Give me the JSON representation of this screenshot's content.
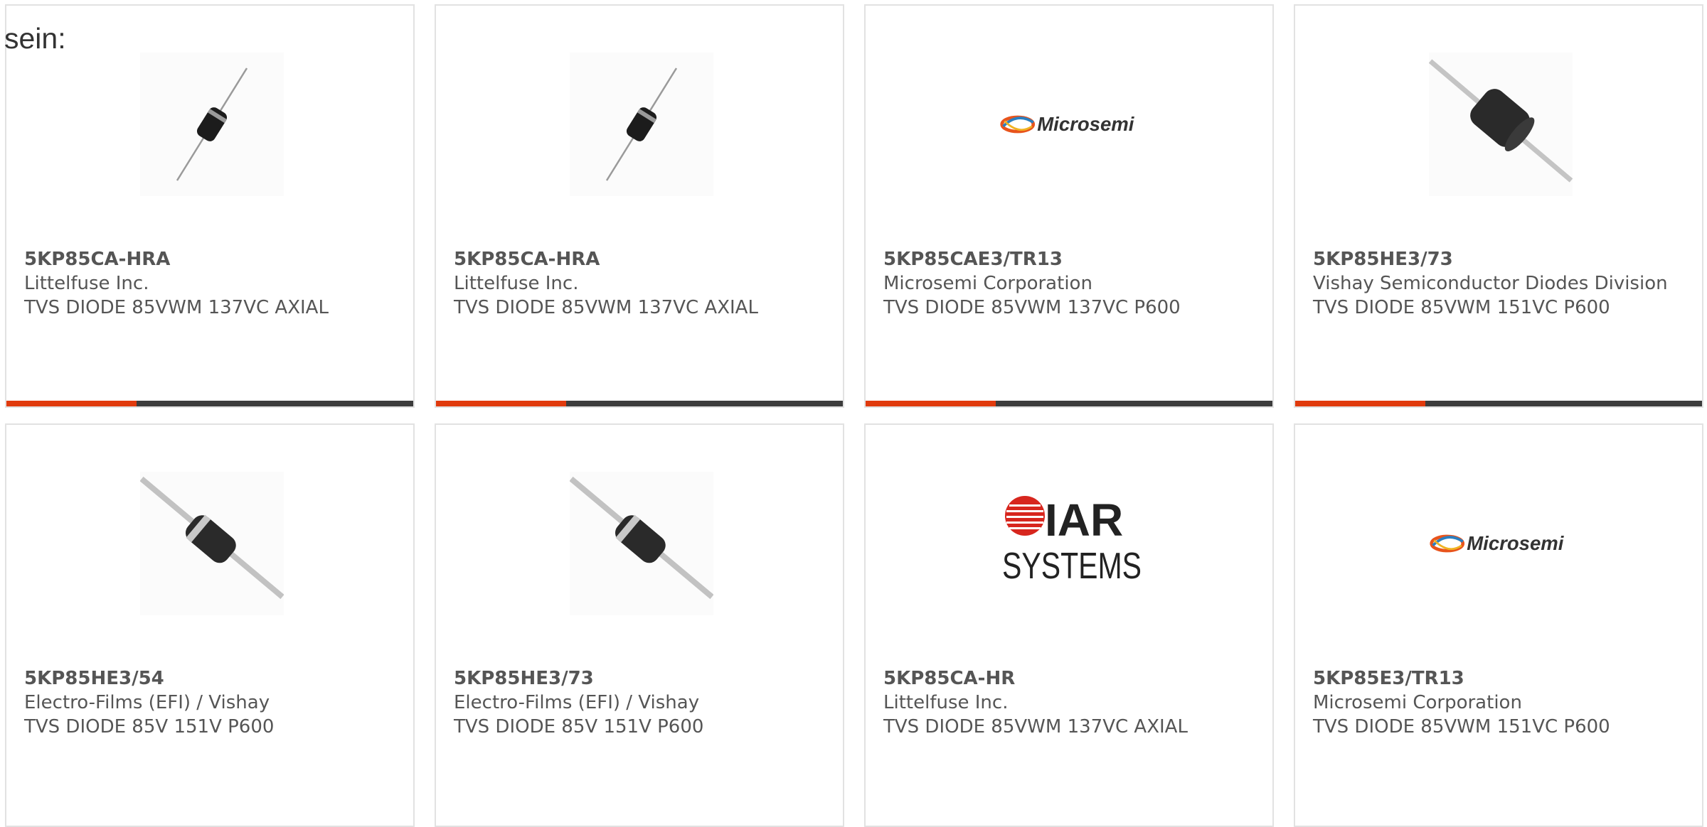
{
  "header": {
    "prefix_text": "sein:"
  },
  "cards": [
    {
      "part": "5KP85CA-HRA",
      "maker": "Littelfuse Inc.",
      "desc": "TVS DIODE 85VWM 137VC AXIAL",
      "image": "small-axial-diode-icon"
    },
    {
      "part": "5KP85CA-HRA",
      "maker": "Littelfuse Inc.",
      "desc": "TVS DIODE 85VWM 137VC AXIAL",
      "image": "small-axial-diode-icon"
    },
    {
      "part": "5KP85CAE3/TR13",
      "maker": "Microsemi Corporation",
      "desc": "TVS DIODE 85VWM 137VC P600",
      "image": "microsemi-logo",
      "logo_text": "Microsemi"
    },
    {
      "part": "5KP85HE3/73",
      "maker": "Vishay Semiconductor Diodes Division",
      "desc": "TVS DIODE 85VWM 151VC P600",
      "image": "large-axial-diode-icon"
    },
    {
      "part": "5KP85HE3/54",
      "maker": "Electro-Films (EFI) / Vishay",
      "desc": "TVS DIODE 85V 151V P600",
      "image": "banded-axial-diode-icon"
    },
    {
      "part": "5KP85HE3/73",
      "maker": "Electro-Films (EFI) / Vishay",
      "desc": "TVS DIODE 85V 151V P600",
      "image": "banded-axial-diode-icon"
    },
    {
      "part": "5KP85CA-HR",
      "maker": "Littelfuse Inc.",
      "desc": "TVS DIODE 85VWM 137VC AXIAL",
      "image": "iar-systems-logo",
      "logo_text_top": "IAR",
      "logo_text_bottom": "SYSTEMS"
    },
    {
      "part": "5KP85E3/TR13",
      "maker": "Microsemi Corporation",
      "desc": "TVS DIODE 85VWM 151VC P600",
      "image": "microsemi-logo",
      "logo_text": "Microsemi"
    }
  ],
  "colors": {
    "accent": "#e03a0d",
    "bar": "#3c3c3c",
    "border": "#e2e2e2",
    "text": "#555555"
  }
}
